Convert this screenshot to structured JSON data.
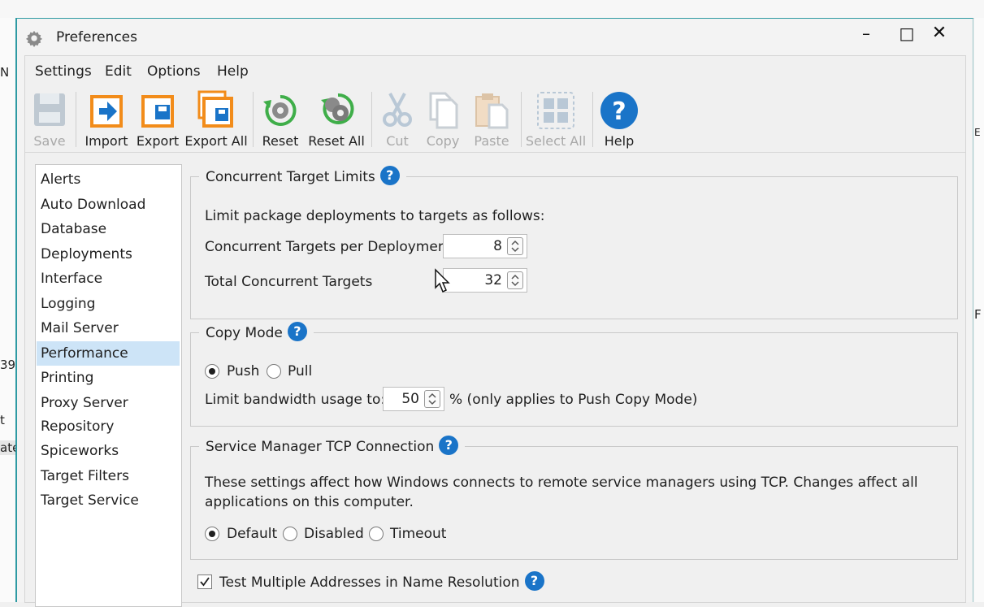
{
  "background": {
    "left_fragments": [
      "N",
      "39",
      "t",
      "ate"
    ],
    "right_fragments": [
      "E",
      "F"
    ]
  },
  "window": {
    "title": "Preferences",
    "controls": {
      "minimize": "–",
      "maximize": "□",
      "close": "✕"
    }
  },
  "menu": [
    "Settings",
    "Edit",
    "Options",
    "Help"
  ],
  "toolbar": {
    "save": "Save",
    "import": "Import",
    "export": "Export",
    "export_all": "Export All",
    "reset": "Reset",
    "reset_all": "Reset All",
    "cut": "Cut",
    "copy": "Copy",
    "paste": "Paste",
    "select_all": "Select All",
    "help": "Help"
  },
  "nav": {
    "items": [
      "Alerts",
      "Auto Download",
      "Database",
      "Deployments",
      "Interface",
      "Logging",
      "Mail Server",
      "Performance",
      "Printing",
      "Proxy Server",
      "Repository",
      "Spiceworks",
      "Target Filters",
      "Target Service"
    ],
    "selected": "Performance"
  },
  "concurrent": {
    "title": "Concurrent Target Limits",
    "description": "Limit package deployments to targets as follows:",
    "per_deployment_label": "Concurrent Targets per Deployment",
    "per_deployment_value": "8",
    "total_label": "Total Concurrent Targets",
    "total_value": "32"
  },
  "copy_mode": {
    "title": "Copy Mode",
    "option_push": "Push",
    "option_pull": "Pull",
    "selected": "Push",
    "bandwidth_label": "Limit bandwidth usage to:",
    "bandwidth_value": "50",
    "bandwidth_suffix": "% (only applies to Push Copy Mode)"
  },
  "service_manager": {
    "title": "Service Manager TCP Connection",
    "description_line1": "These settings affect how Windows connects to remote service managers using TCP. Changes affect all",
    "description_line2": "applications on this computer.",
    "option_default": "Default",
    "option_disabled": "Disabled",
    "option_timeout": "Timeout",
    "selected": "Default"
  },
  "name_resolution": {
    "label": "Test Multiple Addresses in Name Resolution",
    "checked": true
  },
  "help_glyph": "?",
  "colors": {
    "accent": "#2e9aa3",
    "selection": "#cde4f7",
    "help_blue": "#1a74c8",
    "import_orange": "#f28c1a"
  }
}
